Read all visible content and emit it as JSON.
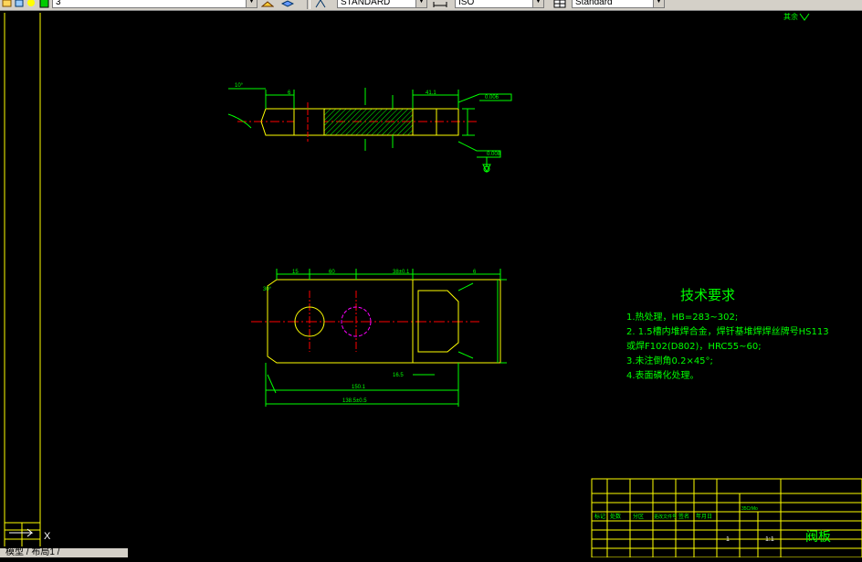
{
  "toolbar": {
    "layer_value": "3",
    "textstyle_value": "STANDARD",
    "dimstyle_value": "ISO",
    "tablestyle_value": "Standard",
    "icons": [
      "layer-manager-icon",
      "layer-previous-icon",
      "lightbulb-icon",
      "sun-icon",
      "color-swatch-icon",
      "layer-state-icon",
      "layer-stack-icon",
      "text-style-icon",
      "dim-style-icon",
      "table-style-icon"
    ]
  },
  "drawing": {
    "top_right_mark": "其余",
    "tech_title": "技术要求",
    "tech_items": [
      "1.热处理，HB=283~302;",
      "2. 1.5槽内堆焊合金，焊钎基堆焊焊丝牌号HS113",
      "   或焊F102(D802)，HRC55~60;",
      "3.未注倒角0.2×45°;",
      "4.表面磷化处理。"
    ],
    "dims": {
      "angle_top": "10°",
      "top_left_dim": "6",
      "top_right_dim": "41.1",
      "flatness_tol": "0.008",
      "parallel_tol": "0.006",
      "pt_30_1": "30°",
      "pt_15": "15",
      "pt_60": "60",
      "pt_38": "38±0.1",
      "pt_6": "6",
      "pt_16": "16.5",
      "pt_150": "150.1",
      "pt_total": "138.5±0.5",
      "pt_height": "1.1"
    }
  },
  "title_block": {
    "part_name": "阀板",
    "material": "35CrMo",
    "scale": "1:1",
    "count": "1",
    "labels": [
      "标记",
      "处数",
      "分区",
      "更改文件号",
      "签名",
      "年月日"
    ]
  },
  "cmd": {
    "tabs_text": "模型 / 布局1 /"
  },
  "colors": {
    "background": "#000000",
    "dim_green": "#00ff00",
    "outline_yellow": "#ffff00",
    "center_red": "#ff0000",
    "hole_magenta": "#ff00ff",
    "text_green": "#00ff00"
  }
}
